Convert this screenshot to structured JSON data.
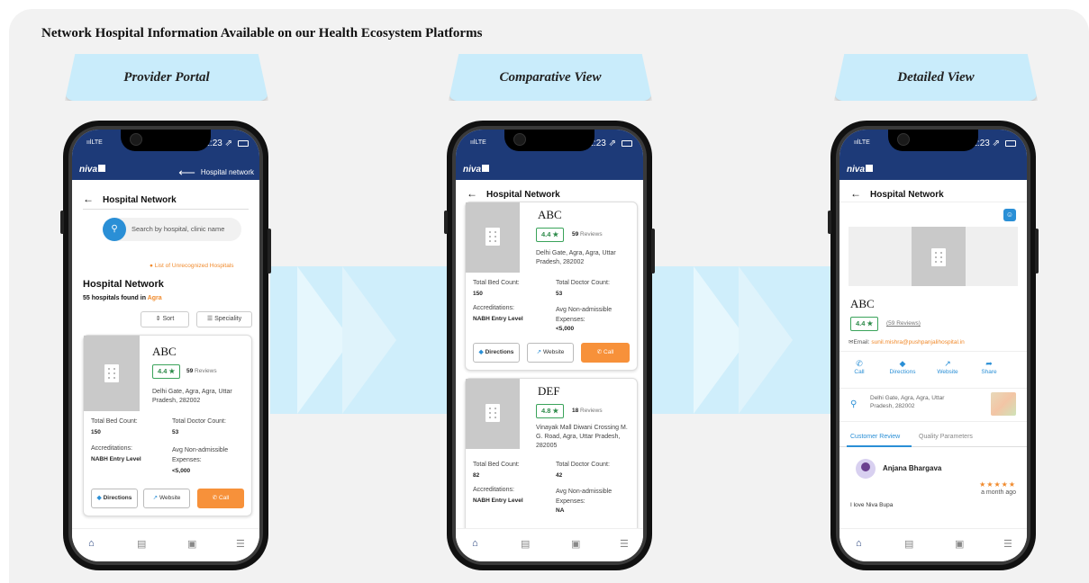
{
  "title": "Network Hospital Information  Available on our Health Ecosystem Platforms",
  "labels": [
    "Provider Portal",
    "Comparative View",
    "Detailed View"
  ],
  "status": {
    "signal": "ıılLTE",
    "time": "1:23 ⇗"
  },
  "app": {
    "logo": "niva",
    "header_nav": "Hospital network",
    "page_header": "Hospital Network"
  },
  "provider": {
    "search_placeholder": "Search by hospital, clinic name",
    "unrecognized": "List of Unrecognized Hospitals",
    "network_title": "Hospital Network",
    "found_prefix": "55 hospitals found in",
    "city": "Agra",
    "sort": "Sort",
    "speciality": "Speciality"
  },
  "hospitals": [
    {
      "name": "ABC",
      "rating": "4.4 ★",
      "reviews_count": "59",
      "reviews_label": "Reviews",
      "address": "Delhi Gate, Agra, Agra, Uttar Pradesh, 282002",
      "bed_label": "Total Bed Count:",
      "bed_count": "150",
      "doctor_label": "Total Doctor Count:",
      "doctor_count": "53",
      "accred_label": "Accreditations:",
      "accred": "NABH Entry Level",
      "expense_label": "Avg Non-admissible Expenses:",
      "expense": "<5,000"
    },
    {
      "name": "DEF",
      "rating": "4.8 ★",
      "reviews_count": "18",
      "reviews_label": "Reviews",
      "address": "Vinayak Mall Diwani Crossing M. G. Road, Agra, Uttar Pradesh, 282005",
      "bed_label": "Total Bed Count:",
      "bed_count": "82",
      "doctor_label": "Total Doctor Count:",
      "doctor_count": "42",
      "accred_label": "Accreditations:",
      "accred": "NABH Entry Level",
      "expense_label": "Avg Non-admissible Expenses:",
      "expense": "NA"
    }
  ],
  "buttons": {
    "directions": "Directions",
    "website": "Website",
    "call": "Call"
  },
  "detail": {
    "name": "ABC",
    "rating": "4.4 ★",
    "reviews": "(59 Reviews)",
    "email_label": "Email:",
    "email": "sunil.mishra@pushpanjalihospital.in",
    "actions": [
      "Call",
      "Directions",
      "Website",
      "Share"
    ],
    "address": "Delhi Gate, Agra, Agra, Uttar Pradesh, 282002",
    "tab1": "Customer Review",
    "tab2": "Quality Parameters",
    "reviewer": "Anjana Bhargava",
    "stars": "★★★★★",
    "ago": "a month ago",
    "review_text": "I love Niva Bupa"
  },
  "colors": {
    "navy": "#1d3a78",
    "accent_blue": "#2a8fd6",
    "orange": "#f7913a",
    "band": "#cfeefb"
  }
}
